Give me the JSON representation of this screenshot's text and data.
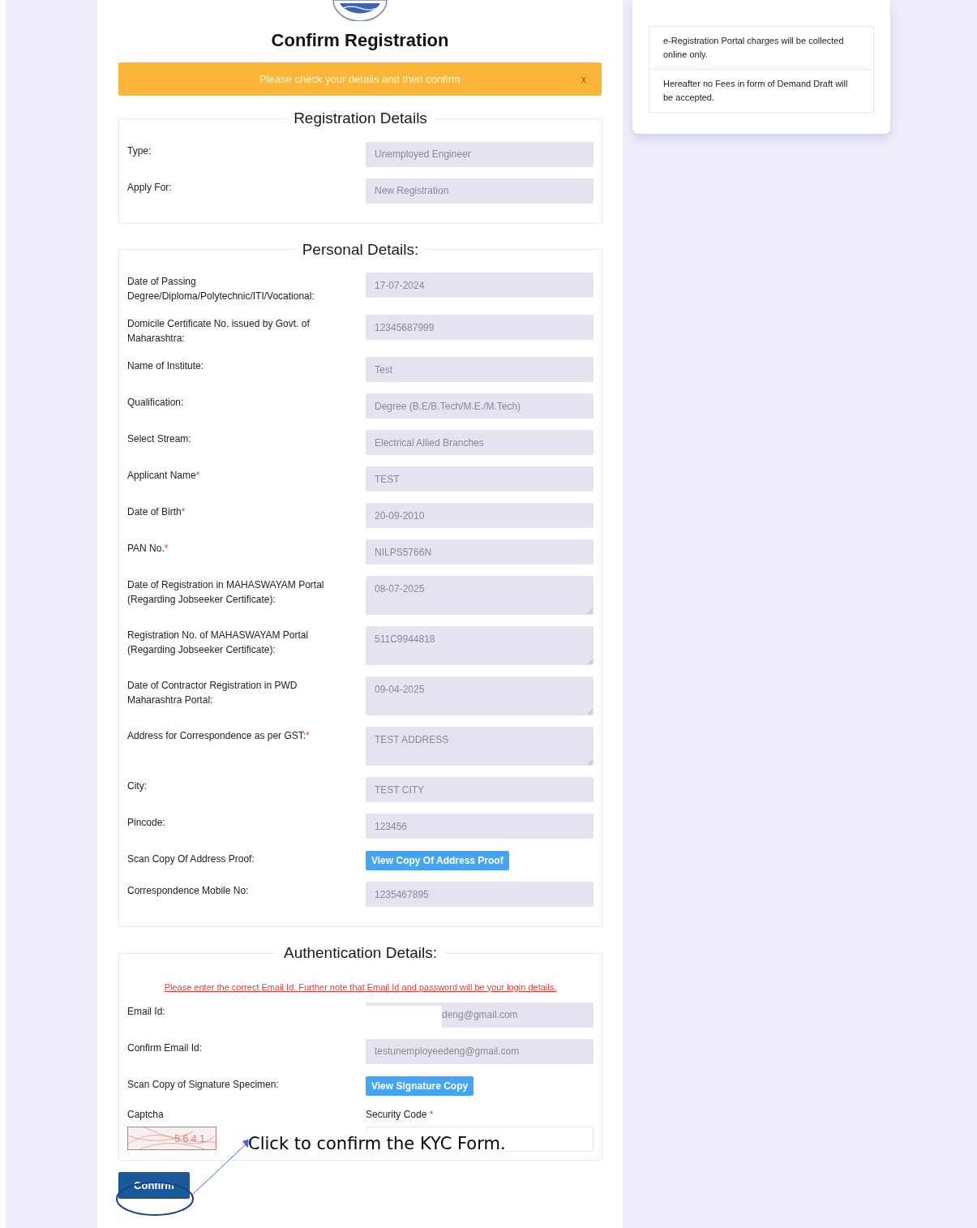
{
  "title": "Confirm Registration",
  "alert": {
    "message": "Please check your details and then confirm",
    "close": "x"
  },
  "sections": [
    {
      "legend": "Registration Details",
      "rows": [
        {
          "kind": "input",
          "label": "Type:",
          "required": false,
          "value": "Unemployed Engineer"
        },
        {
          "kind": "input",
          "label": "Apply For:",
          "required": false,
          "value": "New Registration"
        }
      ]
    },
    {
      "legend": "Personal Details:",
      "rows": [
        {
          "kind": "input",
          "label": "Date of Passing Degree/Diploma/Polytechnic/ITI/Vocational:",
          "required": false,
          "value": "17-07-2024"
        },
        {
          "kind": "input",
          "label": "Domicile Certificate No. issued by Govt. of Maharashtra:",
          "required": false,
          "value": "12345687999"
        },
        {
          "kind": "input",
          "label": "Name of Institute:",
          "required": false,
          "value": "Test"
        },
        {
          "kind": "input",
          "label": "Qualification:",
          "required": false,
          "value": "Degree (B.E/B.Tech/M.E./M.Tech)"
        },
        {
          "kind": "input",
          "label": "Select Stream:",
          "required": false,
          "value": "Electrical Allied Branches"
        },
        {
          "kind": "input",
          "label": "Applicant Name",
          "required": true,
          "value": "TEST"
        },
        {
          "kind": "input",
          "label": "Date of Birth",
          "required": true,
          "value": "20-09-2010"
        },
        {
          "kind": "input",
          "label": "PAN No.",
          "required": true,
          "value": "NILPS5766N"
        },
        {
          "kind": "textarea",
          "label": "Date of Registration in MAHASWAYAM Portal (Regarding Jobseeker Certificate):",
          "required": false,
          "value": "08-07-2025"
        },
        {
          "kind": "textarea",
          "label": "Registration No. of MAHASWAYAM Portal (Regarding Jobseeker Certificate):",
          "required": false,
          "value": "511C9944818"
        },
        {
          "kind": "textarea",
          "label": "Date of Contractor Registration in PWD Maharashtra Portal:",
          "required": false,
          "value": "09-04-2025"
        },
        {
          "kind": "textarea",
          "label": "Address for Correspondence as per GST:",
          "required": true,
          "value": "TEST ADDRESS"
        },
        {
          "kind": "input",
          "label": "City:",
          "required": false,
          "value": "TEST CITY"
        },
        {
          "kind": "input",
          "label": "Pincode:",
          "required": false,
          "value": "123456"
        },
        {
          "kind": "button",
          "label": "Scan Copy Of Address Proof:",
          "required": false,
          "value": "View Copy Of Address Proof"
        },
        {
          "kind": "input",
          "label": "Correspondence Mobile No:",
          "required": false,
          "value": "1235467895"
        }
      ]
    },
    {
      "legend": "Authentication Details:",
      "note": "Please enter the correct Email Id. Further note that Email Id and password will be your login details.",
      "rows": [
        {
          "kind": "redacted",
          "label": "Email Id:",
          "required": false,
          "value": "deng@gmail.com"
        },
        {
          "kind": "input",
          "label": "Confirm Email Id:",
          "required": false,
          "value": "testunemployeedeng@gmail.com"
        },
        {
          "kind": "button",
          "label": "Scan Copy of Signature Specimen:",
          "required": false,
          "value": "View Signature Copy"
        }
      ],
      "captcha": {
        "label": "Captcha",
        "text": "5641"
      },
      "security_code": {
        "label": "Security Code",
        "required": true
      }
    }
  ],
  "required_mark": "*",
  "confirm_button": "Confirm",
  "annotation": "Click to confirm the KYC Form.",
  "notices": [
    "e-Registration Portal charges will be collected online only.",
    "Hereafter no Fees in form of Demand Draft will be accepted."
  ]
}
